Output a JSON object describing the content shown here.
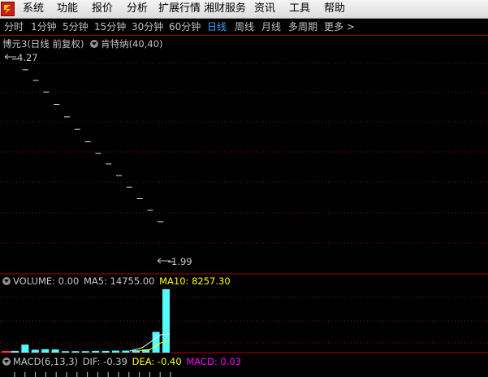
{
  "menu": {
    "items": [
      "系统",
      "功能",
      "报价",
      "分析",
      "扩展行情",
      "湘财服务",
      "资讯",
      "工具",
      "帮助"
    ]
  },
  "periods": {
    "items": [
      "分时",
      "1分钟",
      "5分钟",
      "15分钟",
      "30分钟",
      "60分钟",
      "日线",
      "周线",
      "月线",
      "多周期",
      "更多 >"
    ],
    "active_index": 6
  },
  "main_panel": {
    "title": "博元3(日线 前复权)",
    "indicator": "肯特纳(40,40)",
    "high_label": "4.27",
    "low_label": "1.99"
  },
  "volume_panel": {
    "label": "VOLUME: 0.00",
    "ma5": "MA5: 14755.00",
    "ma10": "MA10: 8257.30"
  },
  "macd_panel": {
    "label": "MACD(6,13,3)",
    "dif": "DIF: -0.39",
    "dea": "DEA: -0.40",
    "macd": "MACD: 0.03"
  },
  "colors": {
    "accent_blue": "#3fa0ff",
    "ma10_yellow": "#ffff00",
    "macd_magenta": "#ff00ff",
    "volume_cyan": "#54fcfc",
    "down_red": "#ff3232",
    "separator_red": "#b00000"
  },
  "chart_data": [
    {
      "type": "line",
      "title": "",
      "x": [
        1,
        2,
        3,
        4,
        5,
        6,
        7,
        8,
        9,
        10,
        11,
        12,
        13,
        14,
        15,
        16
      ],
      "series": [
        {
          "values": [
            4.27,
            4.15,
            4.03,
            3.9,
            3.76,
            3.62,
            3.48,
            3.34,
            3.21,
            3.09,
            2.96,
            2.83,
            2.7,
            2.57,
            2.44,
            1.99
          ]
        }
      ],
      "ylim": [
        1.9,
        4.35
      ],
      "grid": true
    },
    {
      "type": "bar",
      "title": "",
      "categories": [
        1,
        2,
        3,
        4,
        5,
        6,
        7,
        8,
        9,
        10,
        11,
        12,
        13,
        14,
        15,
        16
      ],
      "values": [
        300,
        1400,
        500,
        600,
        550,
        250,
        250,
        250,
        300,
        300,
        350,
        350,
        400,
        550,
        3600,
        11000
      ],
      "ylim": [
        0,
        11000
      ]
    }
  ]
}
